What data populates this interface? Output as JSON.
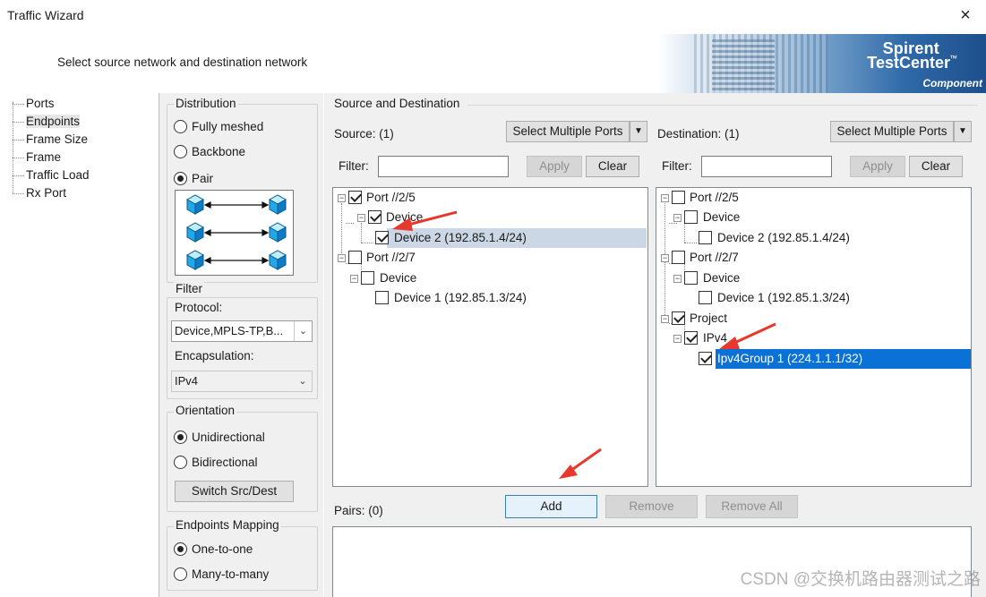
{
  "window": {
    "title": "Traffic Wizard",
    "close_glyph": "×"
  },
  "header": {
    "subtitle": "Select source network and destination network",
    "brand_line1": "Spirent",
    "brand_line2": "TestCenter",
    "brand_tm": "™",
    "brand_line3": "Component"
  },
  "nav": {
    "items": [
      {
        "label": "Ports"
      },
      {
        "label": "Endpoints",
        "selected": true
      },
      {
        "label": "Frame Size"
      },
      {
        "label": "Frame"
      },
      {
        "label": "Traffic Load"
      },
      {
        "label": "Rx Port"
      }
    ]
  },
  "distribution": {
    "title": "Distribution",
    "options": [
      "Fully meshed",
      "Backbone",
      "Pair"
    ],
    "selected": "Pair"
  },
  "filter": {
    "title": "Filter",
    "protocol_label": "Protocol:",
    "protocol_value": "Device,MPLS-TP,B...",
    "encapsulation_label": "Encapsulation:",
    "encapsulation_value": "IPv4"
  },
  "orientation": {
    "title": "Orientation",
    "options": [
      "Unidirectional",
      "Bidirectional"
    ],
    "selected": "Unidirectional",
    "switch_button": "Switch Src/Dest"
  },
  "endpoints_mapping": {
    "title": "Endpoints Mapping",
    "options": [
      "One-to-one",
      "Many-to-many"
    ],
    "selected": "One-to-one"
  },
  "source_destination": {
    "title": "Source and Destination",
    "source": {
      "label": "Source: (1)",
      "select_button": "Select Multiple Ports",
      "filter_label": "Filter:",
      "filter_value": "",
      "apply": "Apply",
      "clear": "Clear",
      "tree": [
        {
          "label": "Port //2/5",
          "checked": true
        },
        {
          "label": "Device",
          "checked": true
        },
        {
          "label": "Device 2 (192.85.1.4/24)",
          "checked": true
        },
        {
          "label": "Port //2/7",
          "checked": false
        },
        {
          "label": "Device",
          "checked": false
        },
        {
          "label": "Device 1 (192.85.1.3/24)",
          "checked": false
        }
      ]
    },
    "destination": {
      "label": "Destination: (1)",
      "select_button": "Select Multiple Ports",
      "filter_label": "Filter:",
      "filter_value": "",
      "apply": "Apply",
      "clear": "Clear",
      "tree": [
        {
          "label": "Port //2/5",
          "checked": false
        },
        {
          "label": "Device",
          "checked": false
        },
        {
          "label": "Device 2 (192.85.1.4/24)",
          "checked": false
        },
        {
          "label": "Port //2/7",
          "checked": false
        },
        {
          "label": "Device",
          "checked": false
        },
        {
          "label": "Device 1 (192.85.1.3/24)",
          "checked": false
        },
        {
          "label": "Project",
          "checked": true
        },
        {
          "label": "IPv4",
          "checked": true
        },
        {
          "label": "Ipv4Group 1 (224.1.1.1/32)",
          "checked": true
        }
      ]
    }
  },
  "pairs": {
    "label": "Pairs: (0)",
    "add": "Add",
    "remove": "Remove",
    "remove_all": "Remove All"
  },
  "watermark": "CSDN @交换机路由器测试之路",
  "colors": {
    "selection": "#0a72d6",
    "highlight": "#cbd7e4",
    "annotation_arrow": "#e8372c"
  }
}
